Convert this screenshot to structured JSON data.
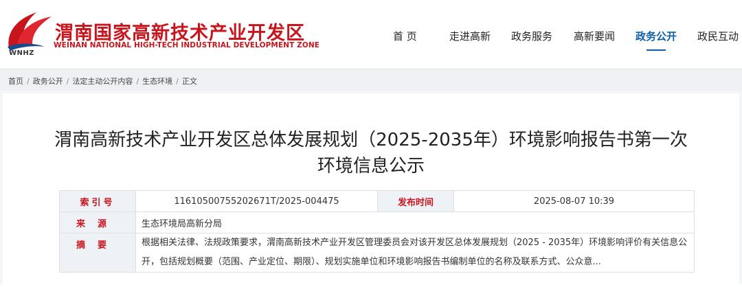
{
  "header": {
    "title_cn": "渭南国家高新技术产业开发区",
    "title_en": "WEINAN NATIONAL HIGH-TECH INDUSTRIAL DEVELOPMENT ZONE",
    "abbr": "WNHZ",
    "logo_icon": "flame-ribbon-logo",
    "brand_color": "#c8151d",
    "accent_color": "#0a5faa"
  },
  "nav": {
    "items": [
      {
        "label": "首  页"
      },
      {
        "label": "走进高新"
      },
      {
        "label": "政务服务"
      },
      {
        "label": "高新要闻"
      },
      {
        "label": "政务公开",
        "active": true
      },
      {
        "label": "政民互动"
      }
    ]
  },
  "breadcrumb": [
    "首页",
    "政务公开",
    "法定主动公开内容",
    "生态环境",
    "正文"
  ],
  "article": {
    "title_line1": "渭南高新技术产业开发区总体发展规划（2025-2035年）环境影响报告书第一次",
    "title_line2": "环境信息公示"
  },
  "meta": {
    "index_label": "索引号",
    "index_value": "11610500755202671T/2025-004475",
    "publish_label": "发布时间",
    "publish_value": "2025-08-07 10:39",
    "source_label": "来源",
    "source_value": "生态环境局高新分局",
    "summary_label": "摘要",
    "summary_value": "根据相关法律、法规政策要求，渭南高新技术产业开发区管理委员会对该开发区总体发展规划（2025 - 2035年）环境影响评价有关信息公开，包括规划概要（范围、产业定位、期限）、规划实施单位和环境影响报告书编制单位的名称及联系方式、公众意..."
  }
}
